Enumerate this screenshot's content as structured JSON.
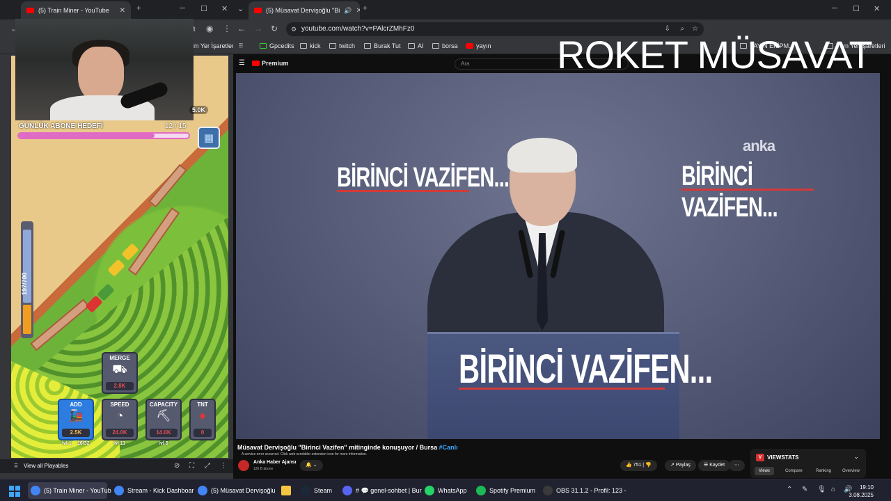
{
  "left_window": {
    "tab_title": "(5) Train Miner - YouTube",
    "bookmarks_tail": "m Yer İşaretleri"
  },
  "game": {
    "abone_label": "GÜNLÜK ABONE HEDEFİ",
    "abone_count": "12 / 15",
    "abone_progress": 0.8,
    "coins": "5.0K",
    "capacity_label": "197/700",
    "capacity_fraction": 0.28,
    "merge": {
      "title": "MERGE",
      "cost": "2.8K"
    },
    "upgrades": [
      {
        "title": "ADD",
        "cost": "2.5K",
        "level": "lvl 1",
        "extra": "16/32",
        "icon": "train-icon"
      },
      {
        "title": "SPEED",
        "cost": "24.0K",
        "level": "lvl 11",
        "icon": "speedometer-icon"
      },
      {
        "title": "CAPACITY",
        "cost": "14.0K",
        "level": "lvl 6",
        "icon": "cart-icon"
      },
      {
        "title": "TNT",
        "cost": "0",
        "icon": "dynamite-icon"
      }
    ],
    "view_all": "View all Playables"
  },
  "right_window": {
    "tab_title": "(5) Müsavat Dervişoğlu \"Bi",
    "url": "youtube.com/watch?v=PAlcrZMhFz0",
    "bookmarks": [
      "Gpcedits",
      "kick",
      "twitch",
      "Burak Tut",
      "AI",
      "borsa",
      "yayın"
    ],
    "bookmarks_right_1": "YAYIN EKİPM...",
    "bookmarks_right_2": "Tüm Yer İşaretleri"
  },
  "overlay_title": "ROKET MÜSAVAT",
  "youtube": {
    "premium_label": "Premium",
    "search_placeholder": "Ara",
    "video_banner": "BİRİNCİ VAZİFEN...",
    "watermark": "anka",
    "title": "Müsavat Dervişoğlu \"Birinci Vazifen\" mitinginde konuşuyor / Bursa",
    "hashtag": "#Canlı",
    "error_text": "A service error occurred. Click web scrobbler extension icon for more information.",
    "channel": "Anka Haber Ajansı",
    "subscribers": "126 B abone",
    "likes": "751",
    "share": "Paylaş",
    "save": "Kaydet",
    "viewstats": {
      "title": "VIEWSTATS",
      "tabs": [
        "Views",
        "Compare",
        "Ranking",
        "Overview"
      ]
    }
  },
  "taskbar": {
    "items": [
      {
        "label": "(5) Train Miner - YouTub",
        "color": "#4285f4"
      },
      {
        "label": "Stream - Kick Dashboar",
        "color": "#4285f4"
      },
      {
        "label": "(5) Müsavat Dervişoğlu",
        "color": "#4285f4"
      },
      {
        "label": "",
        "color": "#f5c542"
      },
      {
        "label": "Steam",
        "color": "#1b2838"
      },
      {
        "label": "# 💬 genel-sohbet | Bur",
        "color": "#5865f2"
      },
      {
        "label": "WhatsApp",
        "color": "#25d366"
      },
      {
        "label": "Spotify Premium",
        "color": "#1db954"
      },
      {
        "label": "OBS 31.1.2 - Profil: 123 -",
        "color": "#3a3a3a"
      }
    ],
    "time": "19:10",
    "date": "3.08.2025"
  }
}
